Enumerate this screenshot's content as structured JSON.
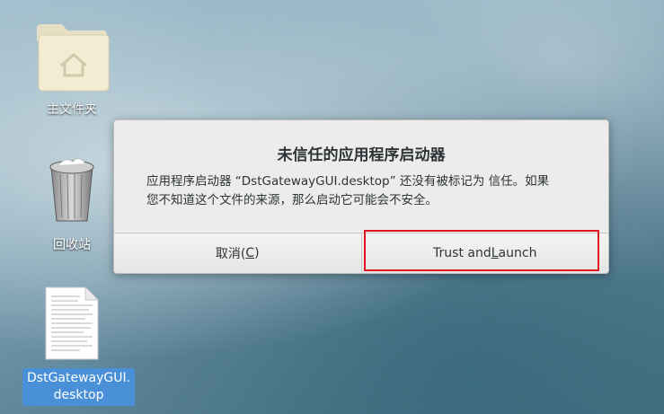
{
  "desktop": {
    "icons": [
      {
        "label": "主文件夹",
        "icon": "home-folder-icon"
      },
      {
        "label": "回收站",
        "icon": "trash-icon"
      },
      {
        "label_line1": "DstGatewayGUI.",
        "label_line2": "desktop",
        "icon": "text-document-icon",
        "selected": true
      }
    ]
  },
  "dialog": {
    "title": "未信任的应用程序启动器",
    "message_line1": "应用程序启动器 “DstGatewayGUI.desktop” 还没有被标记为 信任。如果",
    "message_line2": "您不知道这个文件的来源，那么启动它可能会不安全。",
    "cancel_prefix": "取消(",
    "cancel_mnemonic": "C",
    "cancel_suffix": ")",
    "launch_prefix": "Trust and ",
    "launch_mnemonic": "L",
    "launch_suffix": "aunch"
  },
  "colors": {
    "highlight": "#e0141e",
    "selection": "#4a90d9",
    "dialog_bg": "#ececec"
  }
}
